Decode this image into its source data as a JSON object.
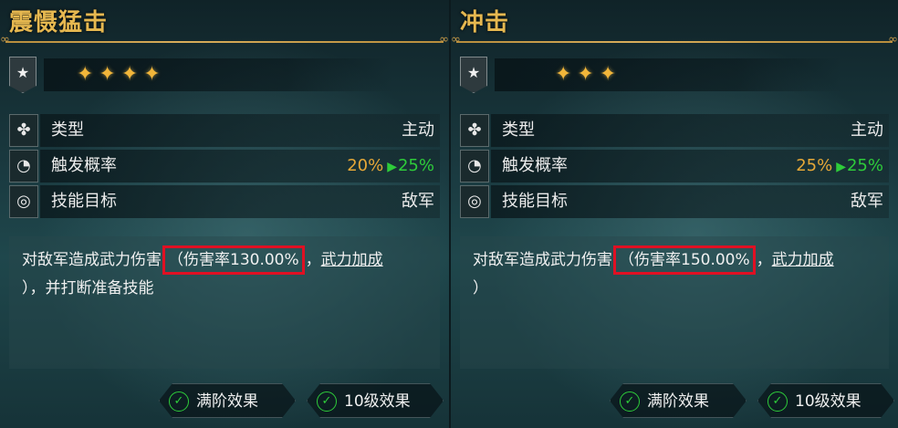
{
  "cards": [
    {
      "title": "震慑猛击",
      "stars": "✦✦✦✦",
      "rows": [
        {
          "label": "类型",
          "value": "主动"
        },
        {
          "label": "触发概率",
          "rate_old": "20%",
          "rate_arrow": "▶",
          "rate_new": "25%"
        },
        {
          "label": "技能目标",
          "value": "敌军"
        }
      ],
      "desc": {
        "prefix": "对敌军造成武力伤害",
        "highlight": "（伤害率130.00%",
        "sep": "，",
        "link": "武力加成",
        "suffix": "），并打断准备技能"
      },
      "buttons": {
        "full": "满阶效果",
        "level10": "10级效果"
      }
    },
    {
      "title": "冲击",
      "stars": "✦✦✦",
      "rows": [
        {
          "label": "类型",
          "value": "主动"
        },
        {
          "label": "触发概率",
          "rate_old": "25%",
          "rate_arrow": "▶",
          "rate_new": "25%"
        },
        {
          "label": "技能目标",
          "value": "敌军"
        }
      ],
      "desc": {
        "prefix": "对敌军造成武力伤害",
        "highlight": "（伤害率150.00%",
        "sep": "，",
        "link": "武力加成",
        "suffix": "）"
      },
      "buttons": {
        "full": "满阶效果",
        "level10": "10级效果"
      }
    }
  ],
  "icons": {
    "star": "★",
    "type": "✤",
    "rate": "◔",
    "target": "◎",
    "check": "✓"
  },
  "colors": {
    "title": "#e6b850",
    "rate_old": "#e6a838",
    "rate_new": "#2ecc3a",
    "highlight_border": "#e01023"
  }
}
